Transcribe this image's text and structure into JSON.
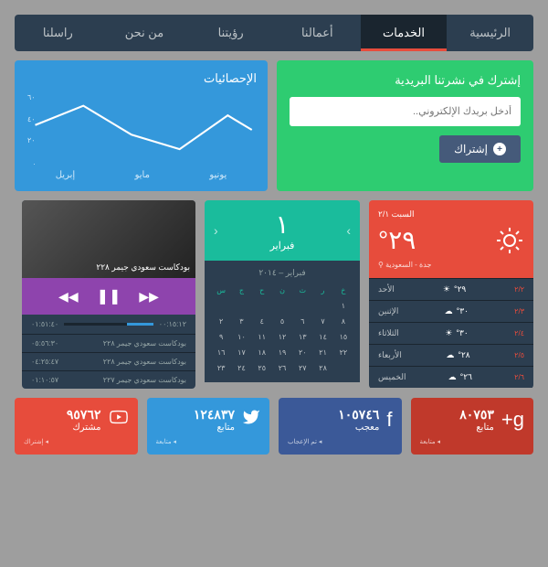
{
  "nav": {
    "items": [
      "الرئيسية",
      "الخدمات",
      "أعمالنا",
      "رؤيتنا",
      "من نحن",
      "راسلنا"
    ],
    "active_index": 1
  },
  "stats": {
    "title": "الإحصائيات",
    "labels": [
      "يونيو",
      "مايو",
      "إبريل"
    ],
    "yticks": [
      "٦٠",
      "٤٠",
      "٢٠",
      "."
    ]
  },
  "chart_data": {
    "type": "line",
    "categories": [
      "إبريل",
      "مايو",
      "يونيو"
    ],
    "values": [
      35,
      20,
      50
    ],
    "ylim": [
      0,
      60
    ],
    "ylabel": "",
    "xlabel": "",
    "title": "الإحصائيات"
  },
  "newsletter": {
    "title": "إشترك في نشرتنا البريدية",
    "placeholder": "أدخل بريدك الإلكتروني..",
    "button": "إشتراك"
  },
  "player": {
    "now_playing": "بودكاست سعودي جيمر ٢٢٨",
    "time_current": "٠١:٥١:٤٠",
    "time_total": "٠٠:١٥:١٢",
    "playlist": [
      {
        "title": "بودكاست سعودي جيمر ٢٢٨",
        "time": "٠٥:٥٦:٣٠"
      },
      {
        "title": "بودكاست سعودي جيمر ٢٢٨",
        "time": "٠٤:٢٥:٤٧"
      },
      {
        "title": "بودكاست سعودي جيمر ٢٢٧",
        "time": "٠١:١٠:٥٧"
      }
    ]
  },
  "calendar": {
    "day": "١",
    "month": "فبراير",
    "header": "فبراير – ٢٠١٤",
    "dow": [
      "خ",
      "ر",
      "ث",
      "ن",
      "ح",
      "ج",
      "س"
    ],
    "cells": [
      "١",
      "",
      "",
      "",
      "",
      "",
      "",
      "٨",
      "٧",
      "٦",
      "٥",
      "٤",
      "٣",
      "٢",
      "١٥",
      "١٤",
      "١٣",
      "١٢",
      "١١",
      "١٠",
      "٩",
      "٢٢",
      "٢١",
      "٢٠",
      "١٩",
      "١٨",
      "١٧",
      "١٦",
      "",
      "٢٨",
      "٢٧",
      "٢٦",
      "٢٥",
      "٢٤",
      "٢٣"
    ]
  },
  "weather": {
    "date": "السبت ٢/١",
    "temp": "٢٩°",
    "location": "جدة - السعودية ⚲",
    "forecast": [
      {
        "day": "الأحد",
        "date": "٢/٢",
        "temp": "٢٩°",
        "icon": "sun"
      },
      {
        "day": "الإثنين",
        "date": "٢/٣",
        "temp": "٣٠°",
        "icon": "cloud"
      },
      {
        "day": "الثلاثاء",
        "date": "٢/٤",
        "temp": "٣٠°",
        "icon": "sun"
      },
      {
        "day": "الأربعاء",
        "date": "٢/٥",
        "temp": "٢٨°",
        "icon": "cloud"
      },
      {
        "day": "الخميس",
        "date": "٢/٦",
        "temp": "٢٦°",
        "icon": "cloud"
      }
    ]
  },
  "social": {
    "youtube": {
      "count": "٩٥٧٦٢",
      "label": "مشترك",
      "action": "◂ إشتراك"
    },
    "twitter": {
      "count": "١٢٤٨٣٧",
      "label": "متابع",
      "action": "◂ متابعة"
    },
    "facebook": {
      "count": "١٠٥٧٤٦",
      "label": "معجب",
      "action": "◂ تم الإعجاب"
    },
    "gplus": {
      "count": "٨٠٧٥٣",
      "label": "متابع",
      "action": "◂ متابعة"
    }
  }
}
